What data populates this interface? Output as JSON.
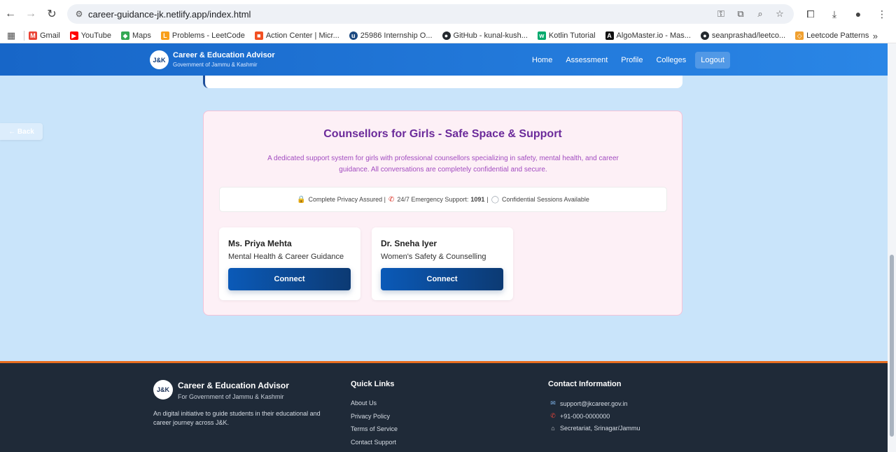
{
  "browser": {
    "url": "career-guidance-jk.netlify.app/index.html",
    "bookmarks": [
      {
        "label": "Gmail",
        "icon": "gmail-icon",
        "color": "#ea4335"
      },
      {
        "label": "YouTube",
        "icon": "youtube-icon",
        "color": "#ff0000"
      },
      {
        "label": "Maps",
        "icon": "maps-icon",
        "color": "#34a853"
      },
      {
        "label": "Problems - LeetCode",
        "icon": "leetcode-icon",
        "color": "#f89f1b"
      },
      {
        "label": "Action Center | Micr...",
        "icon": "microsoft-icon",
        "color": "#f25022"
      },
      {
        "label": "25986 Internship O...",
        "icon": "unstop-icon",
        "color": "#1c4980"
      },
      {
        "label": "GitHub - kunal-kush...",
        "icon": "github-icon",
        "color": "#24292e"
      },
      {
        "label": "Kotlin Tutorial",
        "icon": "w3schools-icon",
        "color": "#04aa6d"
      },
      {
        "label": "AlgoMaster.io - Mas...",
        "icon": "algomaster-icon",
        "color": "#111111"
      },
      {
        "label": "seanprashad/leetco...",
        "icon": "github-icon",
        "color": "#24292e"
      },
      {
        "label": "Leetcode Patterns",
        "icon": "patterns-icon",
        "color": "#f0a030"
      }
    ]
  },
  "header": {
    "logo_text": "J&K",
    "title": "Career & Education Advisor",
    "subtitle": "Government of Jammu & Kashmir",
    "nav": [
      {
        "label": "Home"
      },
      {
        "label": "Assessment"
      },
      {
        "label": "Profile"
      },
      {
        "label": "Colleges"
      }
    ],
    "logout_label": "Logout"
  },
  "back_label": "← Back",
  "girls_section": {
    "title": "Counsellors for Girls - Safe Space & Support",
    "description": "A dedicated support system for girls with professional counsellors specializing in safety, mental health, and career guidance. All conversations are completely confidential and secure.",
    "info": {
      "privacy": "Complete Privacy Assured |",
      "emergency": "24/7 Emergency Support:",
      "emergency_number": "1091",
      "sep": "|",
      "sessions": "Confidential Sessions Available"
    },
    "counsellors": [
      {
        "name": "Ms. Priya Mehta",
        "specialty": "Mental Health & Career Guidance",
        "button": "Connect"
      },
      {
        "name": "Dr. Sneha Iyer",
        "specialty": "Women's Safety & Counselling",
        "button": "Connect"
      }
    ]
  },
  "footer": {
    "logo_text": "J&K",
    "brand": "Career & Education Advisor",
    "sub": "For Government of Jammu & Kashmir",
    "description": "An digital initiative to guide students in their educational and career journey across J&K.",
    "quick_links_title": "Quick Links",
    "quick_links": [
      "About Us",
      "Privacy Policy",
      "Terms of Service",
      "Contact Support"
    ],
    "contact_title": "Contact Information",
    "contacts": [
      {
        "icon": "email-icon",
        "text": "support@jkcareer.gov.in"
      },
      {
        "icon": "phone-icon",
        "text": "+91-000-0000000"
      },
      {
        "icon": "building-icon",
        "text": "Secretariat, Srinagar/Jammu"
      }
    ]
  },
  "colors": {
    "header_start": "#1766c8",
    "header_end": "#2a86e6",
    "section_title": "#6b2a9a",
    "section_text": "#a24cc0",
    "button": "#0b5ab8",
    "footer_bg": "#1f2a38",
    "footer_accent": "#e76d1f"
  }
}
